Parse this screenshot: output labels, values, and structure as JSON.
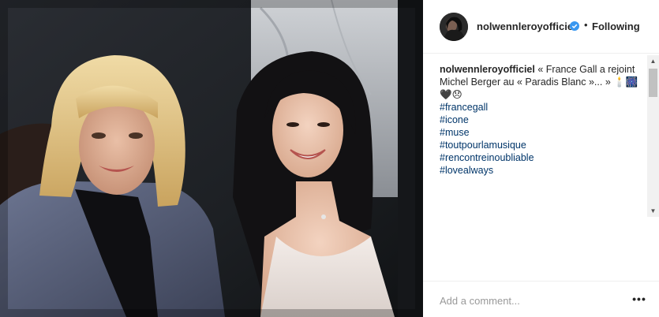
{
  "post": {
    "username": "nolwennleroyofficiel",
    "follow_separator": "•",
    "follow_status": "Following",
    "caption": {
      "username": "nolwennleroyofficiel",
      "text": "« France Gall a rejoint Michel Berger au « Paradis Blanc »... »",
      "emojis": "🕯️🎆🖤😞",
      "hashtags": [
        "#francegall",
        "#icone",
        "#muse",
        "#toutpourlamusique",
        "#rencontreinoubliable",
        "#lovealways"
      ]
    },
    "comment": {
      "placeholder": "Add a comment...",
      "value": ""
    },
    "more_label": "•••"
  },
  "colors": {
    "accent_blue": "#3897f0",
    "hashtag": "#003569",
    "text": "#262626",
    "placeholder": "#999999"
  }
}
